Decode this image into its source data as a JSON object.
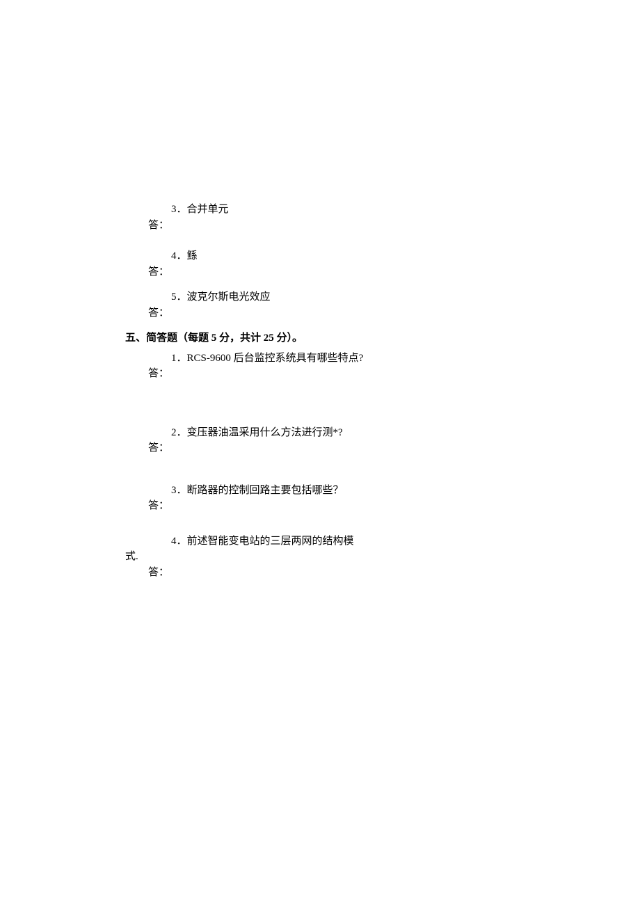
{
  "section4": {
    "items": [
      {
        "num": "3",
        "text": "．合并单元",
        "answer": "答："
      },
      {
        "num": "4",
        "text": "．鲧",
        "answer": "答："
      },
      {
        "num": "5",
        "text": "．波克尔斯电光效应",
        "answer": "答："
      }
    ]
  },
  "section5": {
    "heading": "五、简答题（每题 5 分，共计 25 分）。",
    "questions": [
      {
        "num": "1",
        "text": "．RCS-9600 后台监控系统具有哪些特点?",
        "answer": "答："
      },
      {
        "num": "2",
        "text": "．变压器油温采用什么方法进行测*?",
        "answer": "答："
      },
      {
        "num": "3",
        "text": "．断路器的控制回路主要包括哪些？",
        "answer": "答："
      }
    ],
    "q4": {
      "num": "4",
      "text_a": "．前述智能变电站的三层两网的结构模",
      "wrap": "式.",
      "answer": "答："
    }
  }
}
